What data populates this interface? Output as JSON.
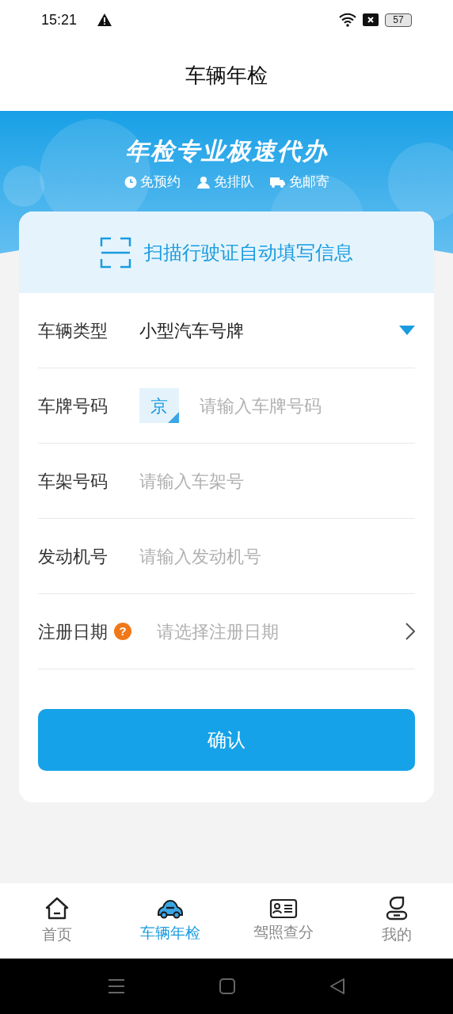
{
  "status_bar": {
    "time": "15:21",
    "battery": "57"
  },
  "header": {
    "title": "车辆年检"
  },
  "banner": {
    "headline": "年检专业极速代办",
    "features": [
      {
        "kind": "clock",
        "label": "免预约"
      },
      {
        "kind": "person",
        "label": "免排队"
      },
      {
        "kind": "truck",
        "label": "免邮寄"
      }
    ]
  },
  "scan": {
    "label": "扫描行驶证自动填写信息"
  },
  "form": {
    "fields": [
      {
        "kind": "select",
        "label": "车辆类型",
        "value": "小型汽车号牌"
      },
      {
        "kind": "plate",
        "label": "车牌号码",
        "province": "京",
        "placeholder": "请输入车牌号码"
      },
      {
        "kind": "input",
        "label": "车架号码",
        "placeholder": "请输入车架号"
      },
      {
        "kind": "input",
        "label": "发动机号",
        "placeholder": "请输入发动机号"
      },
      {
        "kind": "date",
        "label": "注册日期",
        "help": "?",
        "placeholder": "请选择注册日期"
      }
    ]
  },
  "confirm_button": "确认",
  "tab_bar": [
    {
      "kind": "home",
      "label": "首页",
      "selected": false
    },
    {
      "kind": "car",
      "label": "车辆年检",
      "selected": true
    },
    {
      "kind": "license",
      "label": "驾照查分",
      "selected": false
    },
    {
      "kind": "me",
      "label": "我的",
      "selected": false
    }
  ]
}
